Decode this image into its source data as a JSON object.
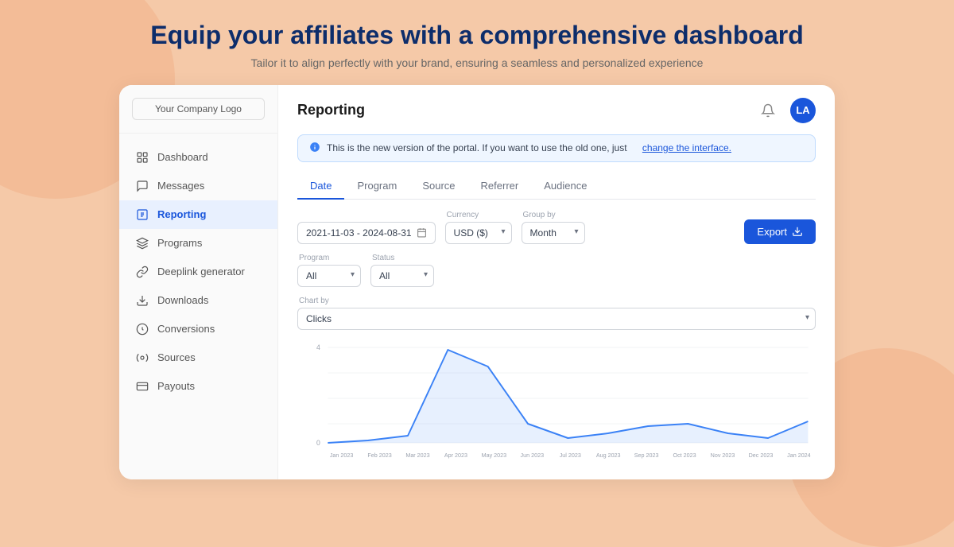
{
  "page": {
    "main_title": "Equip your affiliates with  a comprehensive dashboard",
    "sub_title": "Tailor it to align perfectly with your brand, ensuring a seamless and personalized experience"
  },
  "sidebar": {
    "logo": "Your Company Logo",
    "nav_items": [
      {
        "id": "dashboard",
        "label": "Dashboard",
        "active": false
      },
      {
        "id": "messages",
        "label": "Messages",
        "active": false
      },
      {
        "id": "reporting",
        "label": "Reporting",
        "active": true
      },
      {
        "id": "programs",
        "label": "Programs",
        "active": false
      },
      {
        "id": "deeplink",
        "label": "Deeplink generator",
        "active": false
      },
      {
        "id": "downloads",
        "label": "Downloads",
        "active": false
      },
      {
        "id": "conversions",
        "label": "Conversions",
        "active": false
      },
      {
        "id": "sources",
        "label": "Sources",
        "active": false
      },
      {
        "id": "payouts",
        "label": "Payouts",
        "active": false
      }
    ]
  },
  "header": {
    "title": "Reporting",
    "avatar_initials": "LA"
  },
  "info_banner": {
    "text": "This is the new version of the portal. If you want to use the old one, just",
    "link_text": "change the interface."
  },
  "tabs": [
    {
      "id": "date",
      "label": "Date",
      "active": true
    },
    {
      "id": "program",
      "label": "Program",
      "active": false
    },
    {
      "id": "source",
      "label": "Source",
      "active": false
    },
    {
      "id": "referrer",
      "label": "Referrer",
      "active": false
    },
    {
      "id": "audience",
      "label": "Audience",
      "active": false
    }
  ],
  "filters": {
    "date_range": "2021-11-03 - 2024-08-31",
    "currency_label": "Currency",
    "currency_value": "USD ($)",
    "group_by_label": "Group by",
    "group_by_value": "Month",
    "program_label": "Program",
    "program_value": "All",
    "status_label": "Status",
    "status_value": "All",
    "chart_by_label": "Chart by",
    "chart_by_value": "Clicks",
    "export_label": "Export"
  },
  "chart": {
    "x_labels": [
      "Jan 2023",
      "Feb 2023",
      "Mar 2023",
      "Apr 2023",
      "May 2023",
      "Jun 2023",
      "Jul 2023",
      "Aug 2023",
      "Sep 2023",
      "Oct 2023",
      "Nov 2023",
      "Dec 2023",
      "Jan 2024"
    ],
    "y_max": 4,
    "y_labels": [
      "4",
      "",
      "",
      "",
      "0"
    ],
    "data_points": [
      0,
      0.1,
      0.3,
      3.9,
      3.2,
      0.8,
      0.2,
      0.4,
      0.7,
      0.8,
      0.4,
      0.2,
      0.9
    ]
  },
  "colors": {
    "brand_blue": "#1a56db",
    "active_bg": "#e8f0fe",
    "chart_line": "#3b82f6",
    "chart_fill": "rgba(59,130,246,0.12)"
  }
}
